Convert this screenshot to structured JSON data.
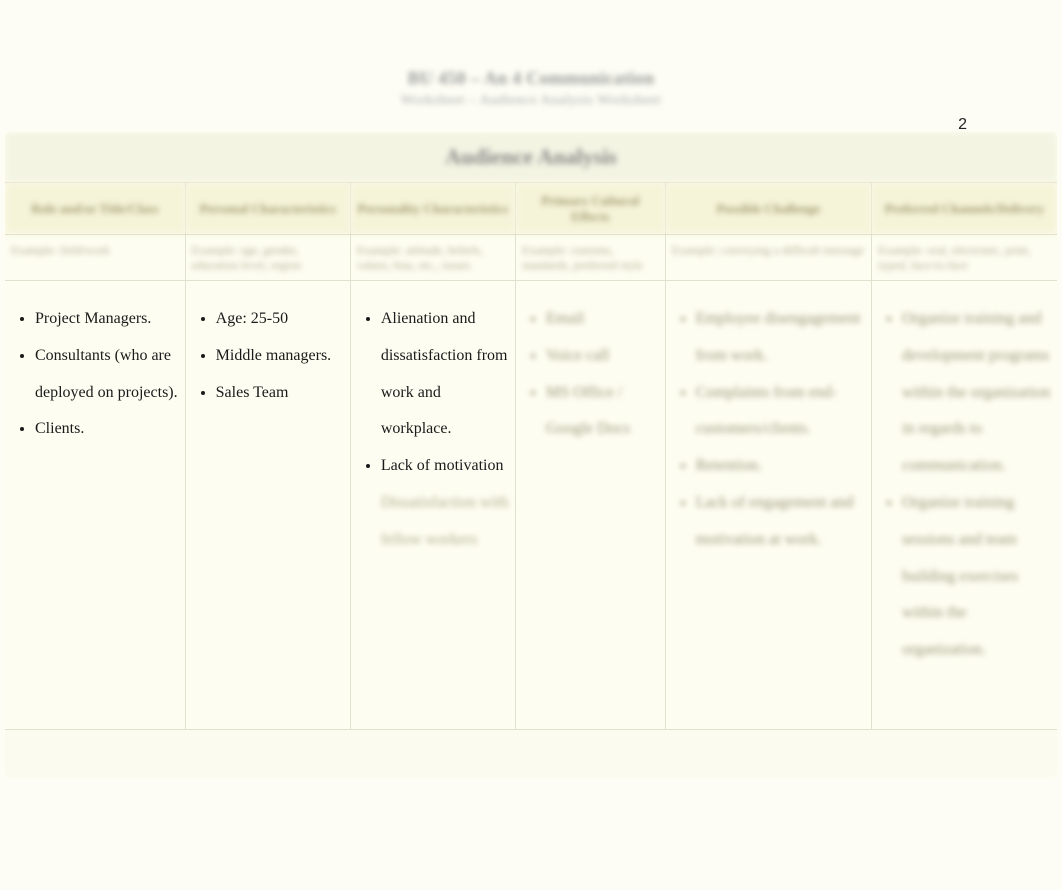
{
  "page_number": "2",
  "title": "BU 450 – An 4 Communication",
  "subtitle": "Worksheet – Audience Analysis Worksheet",
  "table": {
    "main_header": "Audience Analysis",
    "columns": [
      "Role and/or Title/Class",
      "Personal Characteristics",
      "Personality Characteristics",
      "Primary Cultural Effects",
      "Possible Challenge",
      "Preferred Channels/Delivery"
    ],
    "subheads": [
      "Example: field/work",
      "Example: age, gender, education level, region",
      "Example: attitude, beliefs, values, bias, etc., issues",
      "Example: customs, standards, preferred style",
      "Example: conveying a difficult message",
      "Example: oral, electronic, print, typed, face-to-face"
    ],
    "rows": [
      {
        "col1": [
          "Project Managers.",
          "Consultants (who are deployed on projects).",
          "Clients."
        ],
        "col2": [
          "Age: 25-50",
          "Middle managers.",
          "Sales Team"
        ],
        "col3_clear": [
          "Alienation and dissatisfaction from work and workplace.",
          "Lack of motivation"
        ],
        "col3_blur": "Dissatisfaction with fellow workers",
        "col4": [
          "Email",
          "Voice call",
          "MS Office / Google Docs"
        ],
        "col5": [
          "Employee disengagement from work.",
          "Complaints from end-customers/clients.",
          "Retention.",
          "Lack of engagement and motivation at work."
        ],
        "col6": [
          "Organize training and development programs within the organization in regards to communication.",
          "Organize training sessions and team building exercises within the organization."
        ]
      }
    ]
  }
}
